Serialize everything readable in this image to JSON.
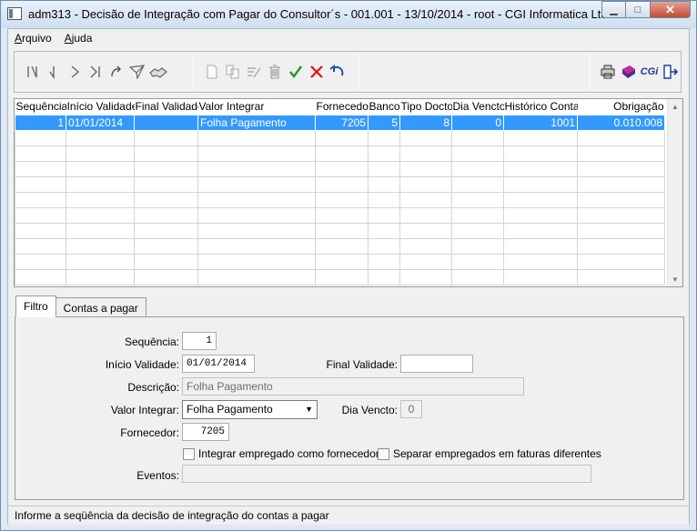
{
  "window": {
    "title": "adm313 - Decisão de Integração com Pagar do Consultor´s - 001.001 - 13/10/2014 - root - CGI Informatica Ltda",
    "minimize": "▁",
    "maximize": "□",
    "close": "✕"
  },
  "menu": {
    "items": [
      "Arquivo",
      "Ajuda"
    ]
  },
  "toolbar": {
    "icons": {
      "first": "first-record-icon",
      "prev": "previous-record-icon",
      "next": "next-record-icon",
      "last": "last-record-icon",
      "refresh": "refresh-icon",
      "filter": "filter-icon",
      "handshake": "handshake-icon",
      "new": "new-record-icon",
      "copy": "copy-icon",
      "edit": "edit-icon",
      "delete": "delete-icon",
      "confirm": "confirm-icon",
      "cancel": "cancel-icon",
      "undo": "undo-icon",
      "print": "print-icon",
      "help": "help-book-icon",
      "cgi": "CGi",
      "exit": "exit-icon"
    }
  },
  "grid": {
    "columns": [
      "Sequência",
      "Início Validade",
      "Final Validade",
      "Valor Integrar",
      "Fornecedor",
      "Banco",
      "Tipo Docto",
      "Dia Vencto",
      "Histórico Contas",
      "Obrigação"
    ],
    "rows": [
      [
        "1",
        "01/01/2014",
        "",
        "Folha Pagamento",
        "7205",
        "5",
        "8",
        "0",
        "1001",
        "0.010.008"
      ]
    ],
    "empty_rows": 10
  },
  "tabs": [
    {
      "label": "Filtro",
      "active": true
    },
    {
      "label": "Contas a pagar",
      "active": false
    }
  ],
  "form": {
    "sequencia_label": "Sequência:",
    "sequencia_value": "1",
    "inicio_label": "Início Validade:",
    "inicio_value": "01/01/2014",
    "final_label": "Final Validade:",
    "final_value": "",
    "descricao_label": "Descrição:",
    "descricao_value": "Folha Pagamento",
    "valor_label": "Valor Integrar:",
    "valor_value": "Folha Pagamento",
    "dia_label": "Dia Vencto:",
    "dia_value": "0",
    "fornecedor_label": "Fornecedor:",
    "fornecedor_value": "7205",
    "chk1_label": "Integrar empregado como fornecedor",
    "chk2_label": "Separar empregados em faturas diferentes",
    "eventos_label": "Eventos:",
    "eventos_value": ""
  },
  "status": {
    "text": "Informe a seqüência da decisão de integração do contas a pagar"
  }
}
